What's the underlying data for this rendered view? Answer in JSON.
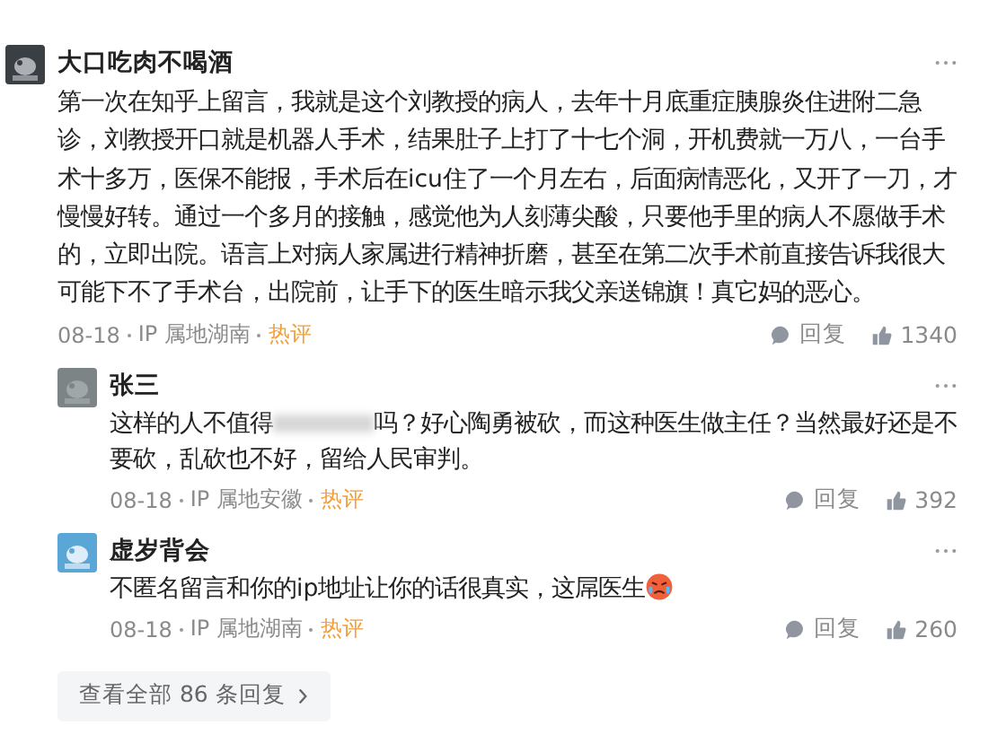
{
  "comment": {
    "author": "大口吃肉不喝酒",
    "segments": [
      {
        "kind": "text",
        "text": "第一次在知乎上留言，我就是这个刘教授的病人，去年十月底重症胰腺炎住进附二急诊，刘教授开口就是机器人手术，结果肚子上打了十七个洞，开机费就一万八，一台手术十多万，医保不能报，手术后在icu住了一个月左右，后面病情恶化，又开了一刀，才慢慢好转。通过一个多月的接触，感觉他为人刻薄尖酸，只要他手里的病人不愿做手术的，立即出院。语言上对病人家属进行精神折磨，甚至在第二次手术前直接告诉我很大可能下不了手术台，出院前，让手下的医生暗示我父亲送锦旗！真它妈的恶心。"
      }
    ],
    "date": "08-18",
    "location": "IP 属地湖南",
    "tag": "热评",
    "reply_label": "回复",
    "likes": "1340",
    "replies": [
      {
        "author": "张三",
        "segments": [
          {
            "kind": "text",
            "text": "这样的人不值得"
          },
          {
            "kind": "redacted"
          },
          {
            "kind": "text",
            "text": "吗？好心陶勇被砍，而这种医生做主任？当然最好还是不要砍，乱砍也不好，留给人民审判。"
          }
        ],
        "date": "08-18",
        "location": "IP 属地安徽",
        "tag": "热评",
        "reply_label": "回复",
        "likes": "392"
      },
      {
        "author": "虚岁背会",
        "segments": [
          {
            "kind": "text",
            "text": "不匿名留言和你的ip地址让你的话很真实，这屌医生"
          },
          {
            "kind": "angry-emoji"
          }
        ],
        "date": "08-18",
        "location": "IP 属地湖南",
        "tag": "热评",
        "reply_label": "回复",
        "likes": "260"
      }
    ],
    "view_all": "查看全部 86 条回复"
  }
}
